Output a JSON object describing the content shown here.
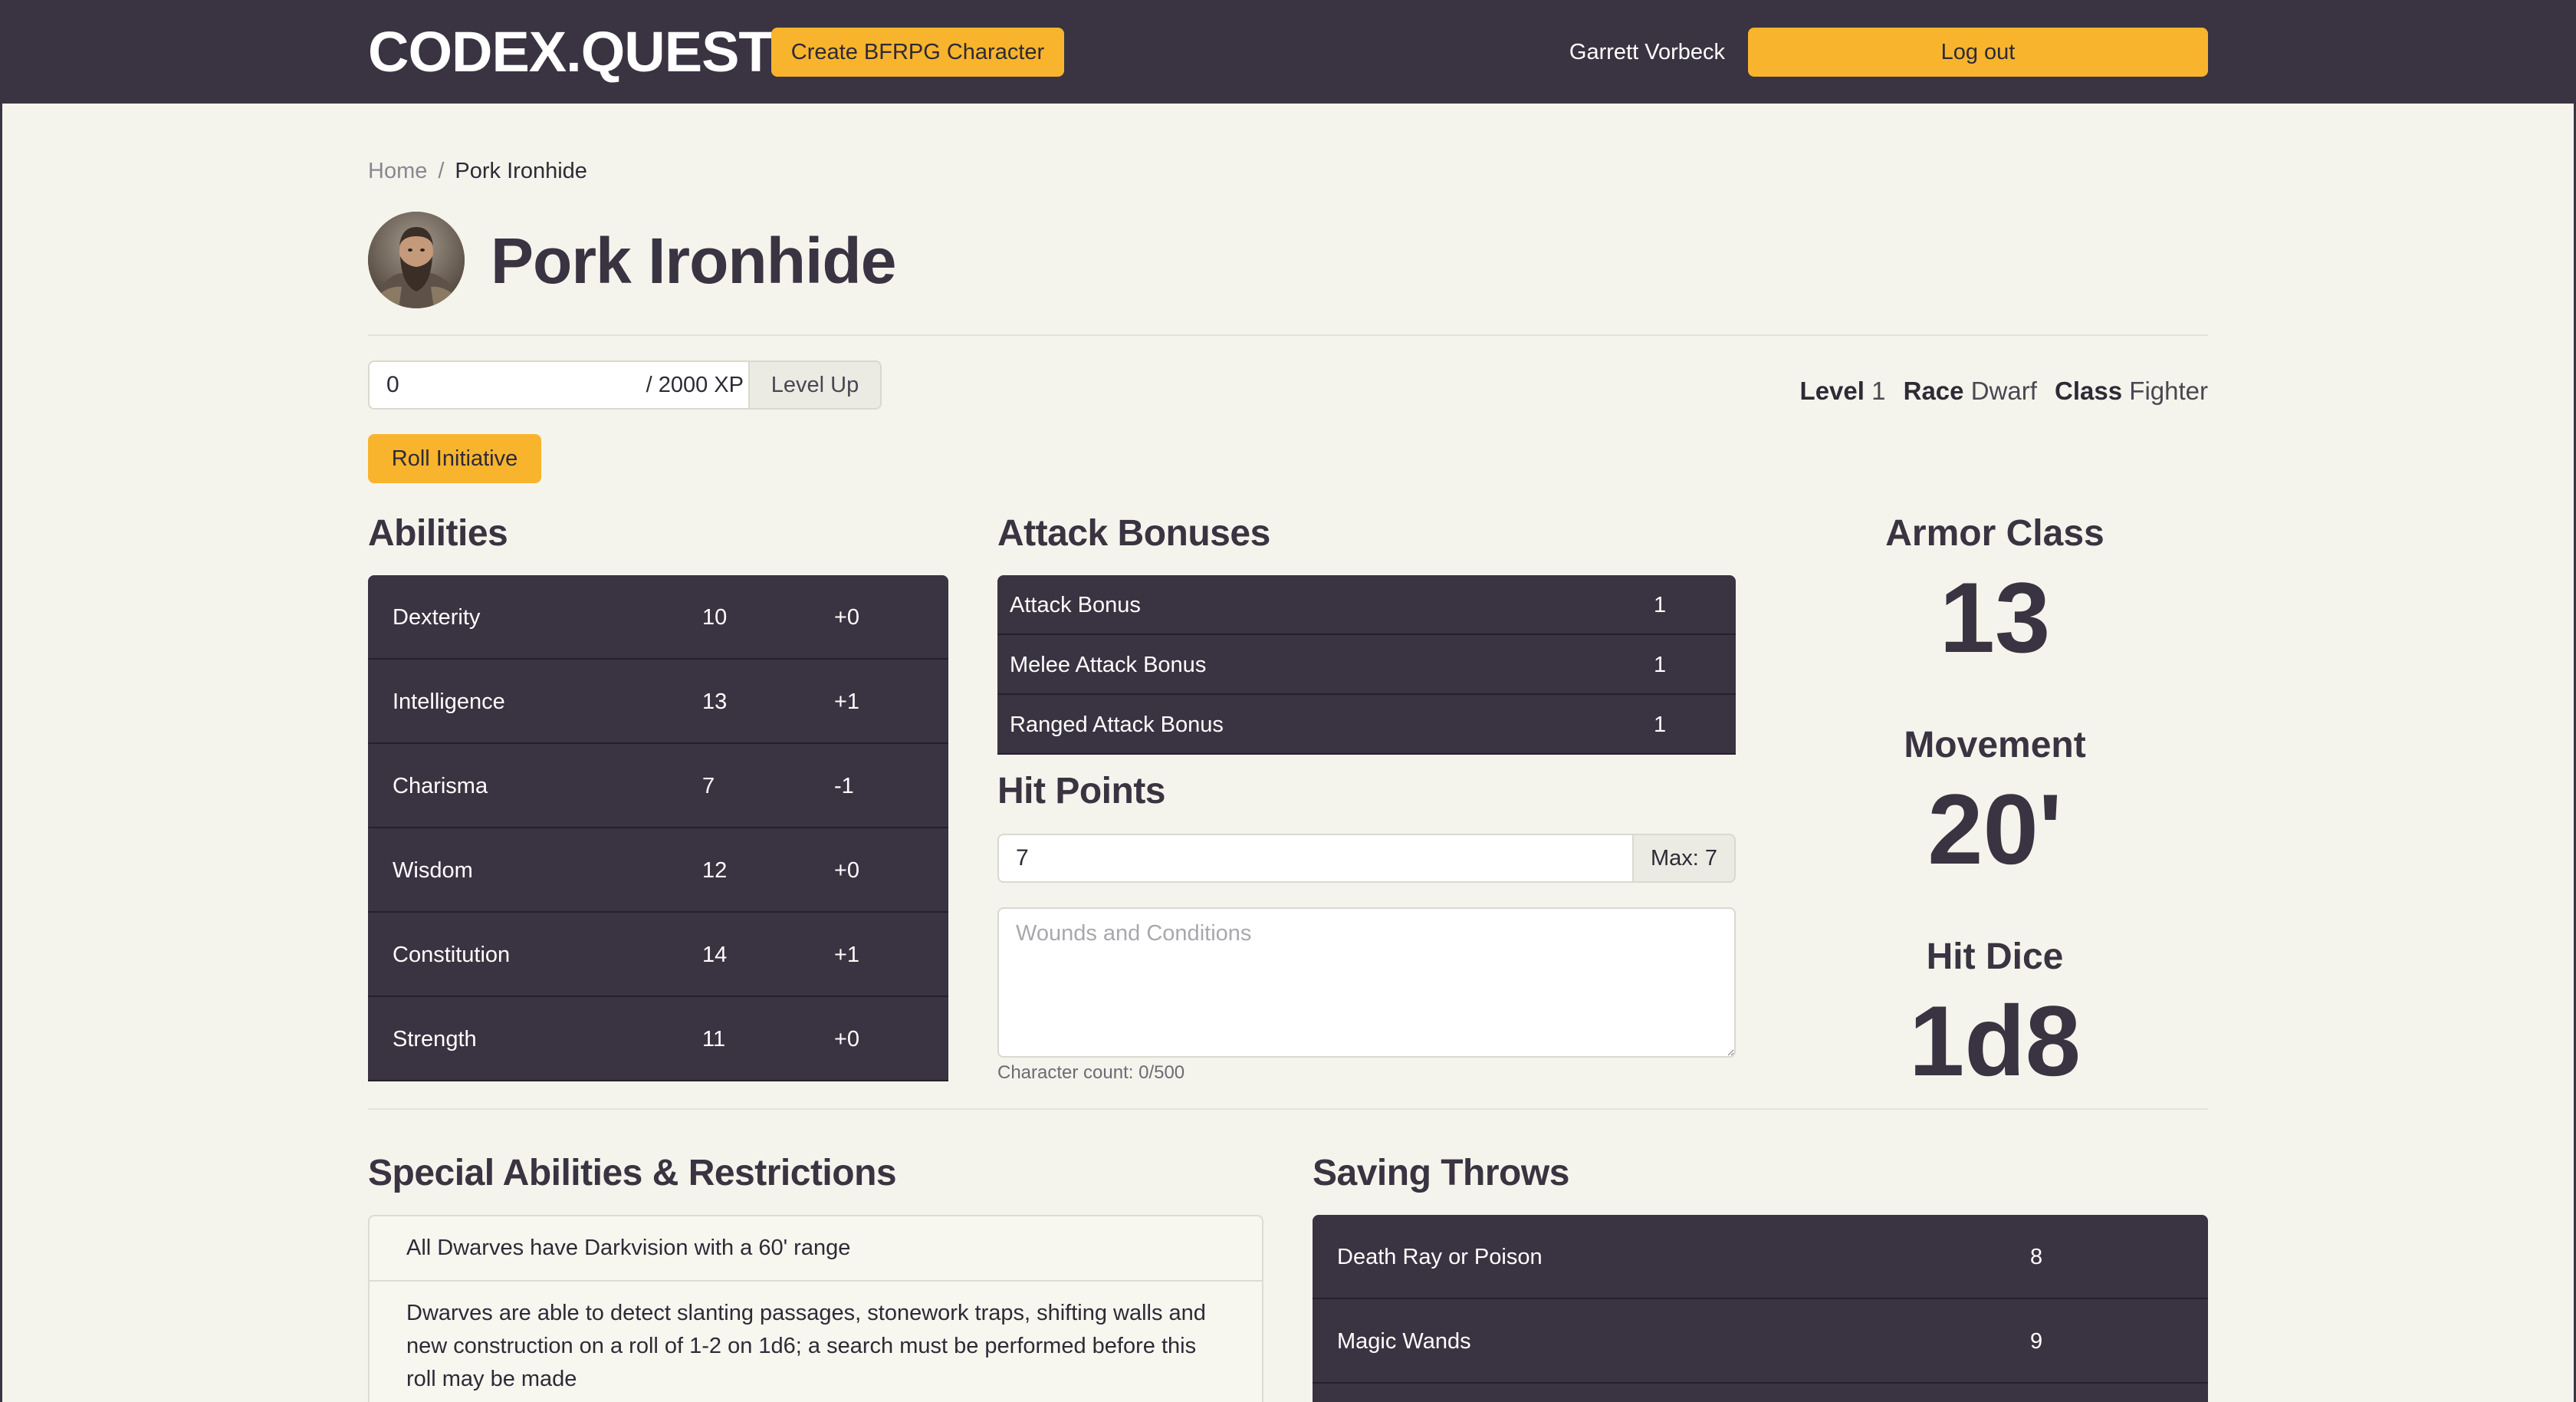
{
  "navbar": {
    "brand": "CODEX.QUEST",
    "create_label": "Create BFRPG Character",
    "user": "Garrett Vorbeck",
    "logout_label": "Log out"
  },
  "breadcrumb": {
    "home": "Home",
    "separator": "/",
    "current": "Pork Ironhide"
  },
  "character": {
    "name": "Pork Ironhide",
    "xp_value": "0",
    "xp_max": "/ 2000 XP",
    "level_up_label": "Level Up",
    "level_label": "Level",
    "level": "1",
    "race_label": "Race",
    "race": "Dwarf",
    "class_label": "Class",
    "class": "Fighter",
    "roll_initiative_label": "Roll Initiative"
  },
  "abilities": {
    "heading": "Abilities",
    "rows": [
      {
        "name": "Dexterity",
        "score": "10",
        "mod": "+0"
      },
      {
        "name": "Intelligence",
        "score": "13",
        "mod": "+1"
      },
      {
        "name": "Charisma",
        "score": "7",
        "mod": "-1"
      },
      {
        "name": "Wisdom",
        "score": "12",
        "mod": "+0"
      },
      {
        "name": "Constitution",
        "score": "14",
        "mod": "+1"
      },
      {
        "name": "Strength",
        "score": "11",
        "mod": "+0"
      }
    ]
  },
  "attack": {
    "heading": "Attack Bonuses",
    "rows": [
      {
        "name": "Attack Bonus",
        "value": "1"
      },
      {
        "name": "Melee Attack Bonus",
        "value": "1"
      },
      {
        "name": "Ranged Attack Bonus",
        "value": "1"
      }
    ]
  },
  "hit_points": {
    "heading": "Hit Points",
    "value": "7",
    "max": "Max: 7",
    "wounds_placeholder": "Wounds and Conditions",
    "char_count": "Character count: 0/500"
  },
  "stats": {
    "armor_class_label": "Armor Class",
    "armor_class": "13",
    "movement_label": "Movement",
    "movement": "20'",
    "hit_dice_label": "Hit Dice",
    "hit_dice": "1d8"
  },
  "special": {
    "heading": "Special Abilities & Restrictions",
    "items": [
      "All Dwarves have Darkvision with a 60' range",
      "Dwarves are able to detect slanting passages, stonework traps, shifting walls and new construction on a roll of 1-2 on 1d6; a search must be performed before this roll may be made"
    ]
  },
  "saving_throws": {
    "heading": "Saving Throws",
    "rows": [
      {
        "name": "Death Ray or Poison",
        "value": "8"
      },
      {
        "name": "Magic Wands",
        "value": "9"
      }
    ]
  },
  "colors": {
    "navbar": "#3a3341",
    "accent": "#f8b42c",
    "background": "#f4f4ec"
  },
  "icons": {
    "avatar": "character-portrait"
  }
}
